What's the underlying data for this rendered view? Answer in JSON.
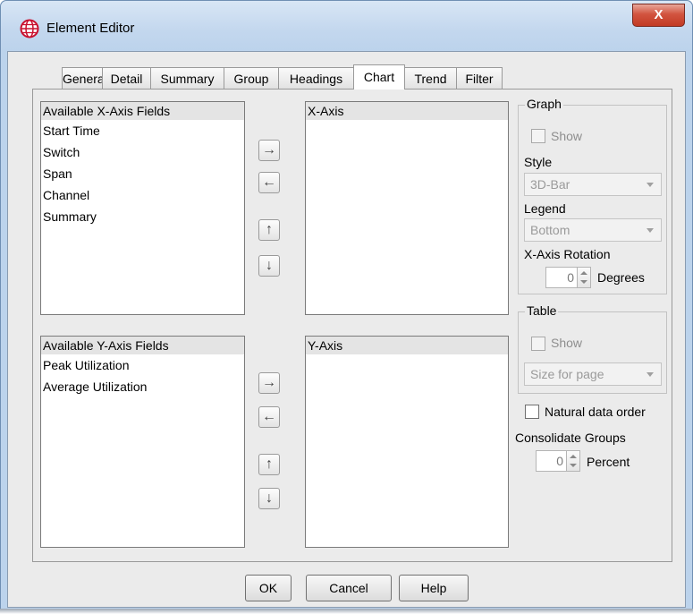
{
  "window": {
    "title": "Element Editor",
    "close_label": "X",
    "app_icon": "globe-icon"
  },
  "tabs": [
    {
      "label": "General"
    },
    {
      "label": "Detail"
    },
    {
      "label": "Summary"
    },
    {
      "label": "Group"
    },
    {
      "label": "Headings"
    },
    {
      "label": "Chart",
      "active": true
    },
    {
      "label": "Trend"
    },
    {
      "label": "Filter"
    }
  ],
  "x_available": {
    "header": "Available X-Axis Fields",
    "items": [
      "Start Time",
      "Switch",
      "Span",
      "Channel",
      "Summary"
    ]
  },
  "x_selected": {
    "header": "X-Axis",
    "items": []
  },
  "y_available": {
    "header": "Available Y-Axis Fields",
    "items": [
      "Peak Utilization",
      "Average Utilization"
    ]
  },
  "y_selected": {
    "header": "Y-Axis",
    "items": []
  },
  "arrows": {
    "right": "→",
    "left": "←",
    "up": "↑",
    "down": "↓"
  },
  "graph": {
    "group_label": "Graph",
    "show_label": "Show",
    "show_checked": false,
    "style_label": "Style",
    "style_value": "3D-Bar",
    "legend_label": "Legend",
    "legend_value": "Bottom",
    "rotation_label": "X-Axis Rotation",
    "rotation_value": "0",
    "rotation_unit": "Degrees"
  },
  "table": {
    "group_label": "Table",
    "show_label": "Show",
    "show_checked": false,
    "size_value": "Size for page"
  },
  "natural_order": {
    "label": "Natural data order",
    "checked": false
  },
  "consolidate": {
    "label": "Consolidate Groups",
    "value": "0",
    "unit": "Percent"
  },
  "buttons": {
    "ok": "OK",
    "cancel": "Cancel",
    "help": "Help"
  },
  "colors": {
    "title_bar": "#c3d7ee",
    "close_button": "#c23a24",
    "dialog_bg": "#ebebeb"
  }
}
